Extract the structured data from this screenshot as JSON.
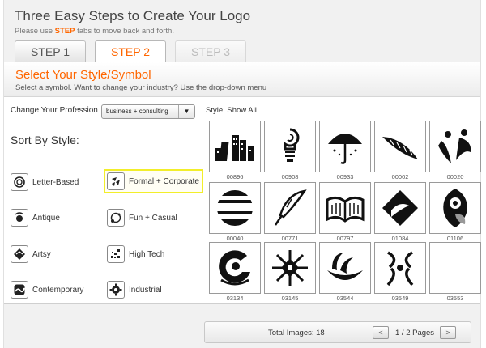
{
  "header": {
    "title": "Three Easy Steps to Create Your Logo",
    "subtitle_pre": "Please use ",
    "subtitle_em": "STEP",
    "subtitle_post": " tabs to move back and forth."
  },
  "tabs": [
    {
      "label": "STEP 1",
      "state": "normal"
    },
    {
      "label": "STEP 2",
      "state": "active"
    },
    {
      "label": "STEP 3",
      "state": "disabled"
    }
  ],
  "section": {
    "title": "Select Your Style/Symbol",
    "description": "Select a symbol. Want to change your industry? Use the drop-down menu"
  },
  "profession": {
    "label": "Change Your Profession",
    "selected": "business + consulting",
    "arrow_icon": "triangle-down-icon"
  },
  "sort": {
    "title": "Sort By Style:",
    "styles": [
      {
        "label": "Letter-Based",
        "icon": "letter-based-icon",
        "selected": false
      },
      {
        "label": "Formal + Corporate",
        "icon": "formal-corporate-icon",
        "selected": true
      },
      {
        "label": "Antique",
        "icon": "antique-icon",
        "selected": false
      },
      {
        "label": "Fun + Casual",
        "icon": "fun-casual-icon",
        "selected": false
      },
      {
        "label": "Artsy",
        "icon": "artsy-icon",
        "selected": false
      },
      {
        "label": "High Tech",
        "icon": "high-tech-icon",
        "selected": false
      },
      {
        "label": "Contemporary",
        "icon": "contemporary-icon",
        "selected": false
      },
      {
        "label": "Industrial",
        "icon": "industrial-icon",
        "selected": false
      }
    ]
  },
  "gallery": {
    "label": "Style: Show All",
    "items": [
      {
        "id": "00896",
        "icon": "city-buildings-icon"
      },
      {
        "id": "00908",
        "icon": "lightbulb-swirl-icon"
      },
      {
        "id": "00933",
        "icon": "umbrella-icon"
      },
      {
        "id": "00002",
        "icon": "feather-leaf-icon"
      },
      {
        "id": "00020",
        "icon": "two-figures-icon"
      },
      {
        "id": "00040",
        "icon": "striped-circle-icon"
      },
      {
        "id": "00771",
        "icon": "quill-pen-icon"
      },
      {
        "id": "00797",
        "icon": "open-book-icon"
      },
      {
        "id": "01084",
        "icon": "folded-square-icon"
      },
      {
        "id": "01106",
        "icon": "swirl-shield-icon"
      },
      {
        "id": "03134",
        "icon": "partial-circle-icon"
      },
      {
        "id": "03145",
        "icon": "tribal-star-icon"
      },
      {
        "id": "03544",
        "icon": "wave-bowl-icon"
      },
      {
        "id": "03549",
        "icon": "arc-figure-icon"
      },
      {
        "id": "03553",
        "icon": "blank-icon"
      }
    ]
  },
  "footer": {
    "total": "Total Images: 18",
    "pages": "1 / 2 Pages",
    "prev_icon": "chevron-left-icon",
    "next_icon": "chevron-right-icon",
    "prev_glyph": "<",
    "next_glyph": ">"
  }
}
